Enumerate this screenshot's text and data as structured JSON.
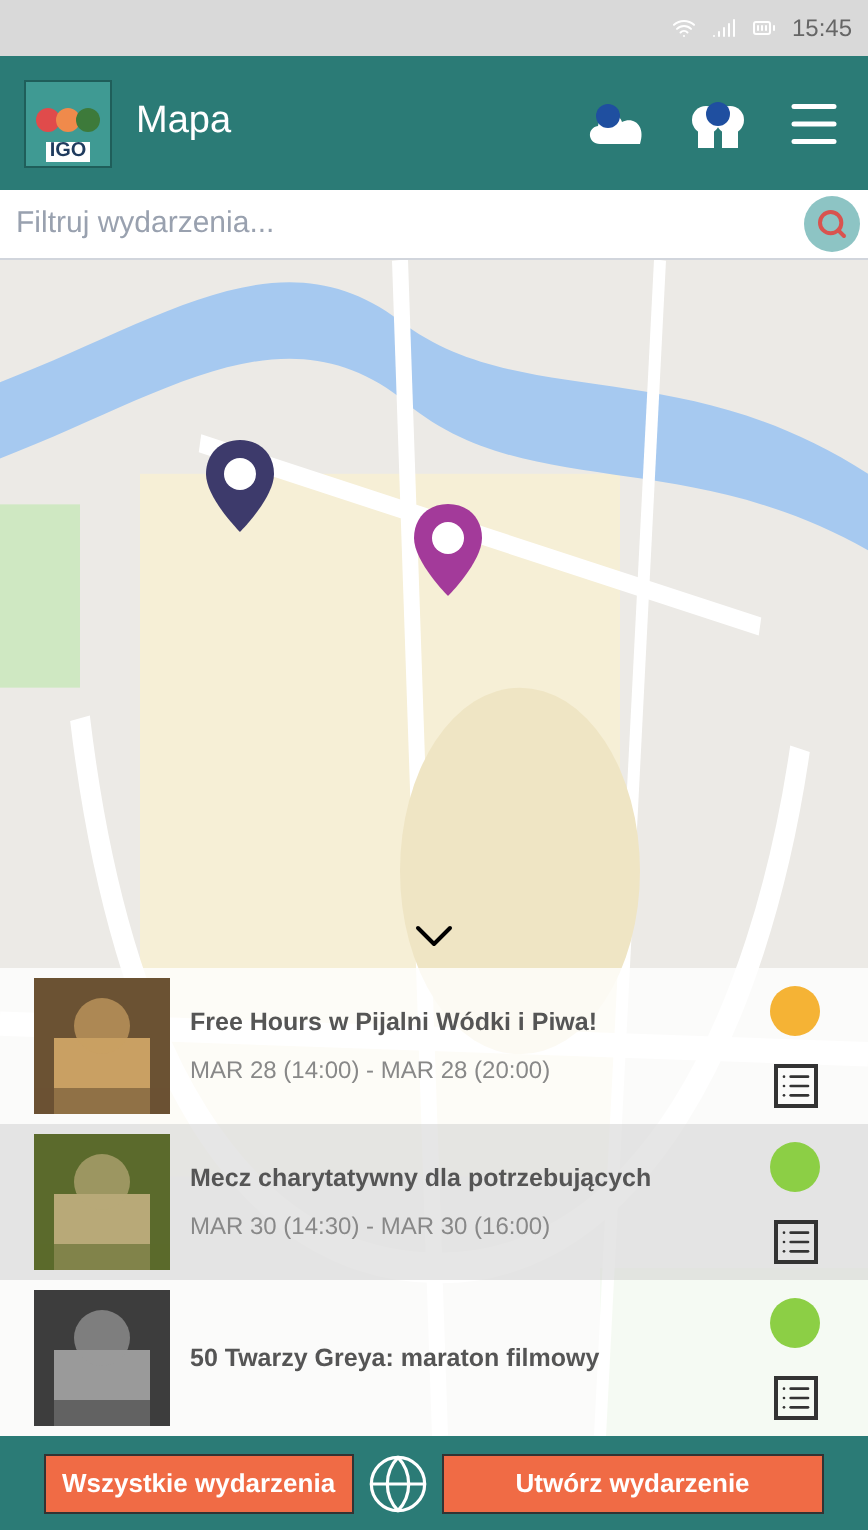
{
  "status_bar": {
    "time": "15:45"
  },
  "header": {
    "logo": "IGO",
    "title": "Mapa"
  },
  "search": {
    "placeholder": "Filtruj wydarzenia..."
  },
  "map": {
    "pins": [
      {
        "color": "#3d3a6b"
      },
      {
        "color": "#a33a9a"
      }
    ]
  },
  "events": [
    {
      "title": "Free Hours w Pijalni Wódki i Piwa!",
      "dates": "MAR 28 (14:00) - MAR 28 (20:00)",
      "color": "#f5b335",
      "selected": false
    },
    {
      "title": "Mecz charytatywny dla potrzebujących",
      "dates": "MAR 30 (14:30) - MAR 30 (16:00)",
      "color": "#8ccf45",
      "selected": true
    },
    {
      "title": "50 Twarzy Greya: maraton filmowy",
      "color": "#8ccf45",
      "selected": false
    }
  ],
  "footer": {
    "left_button": "Wszystkie wydarzenia",
    "right_button": "Utwórz wydarzenie"
  }
}
